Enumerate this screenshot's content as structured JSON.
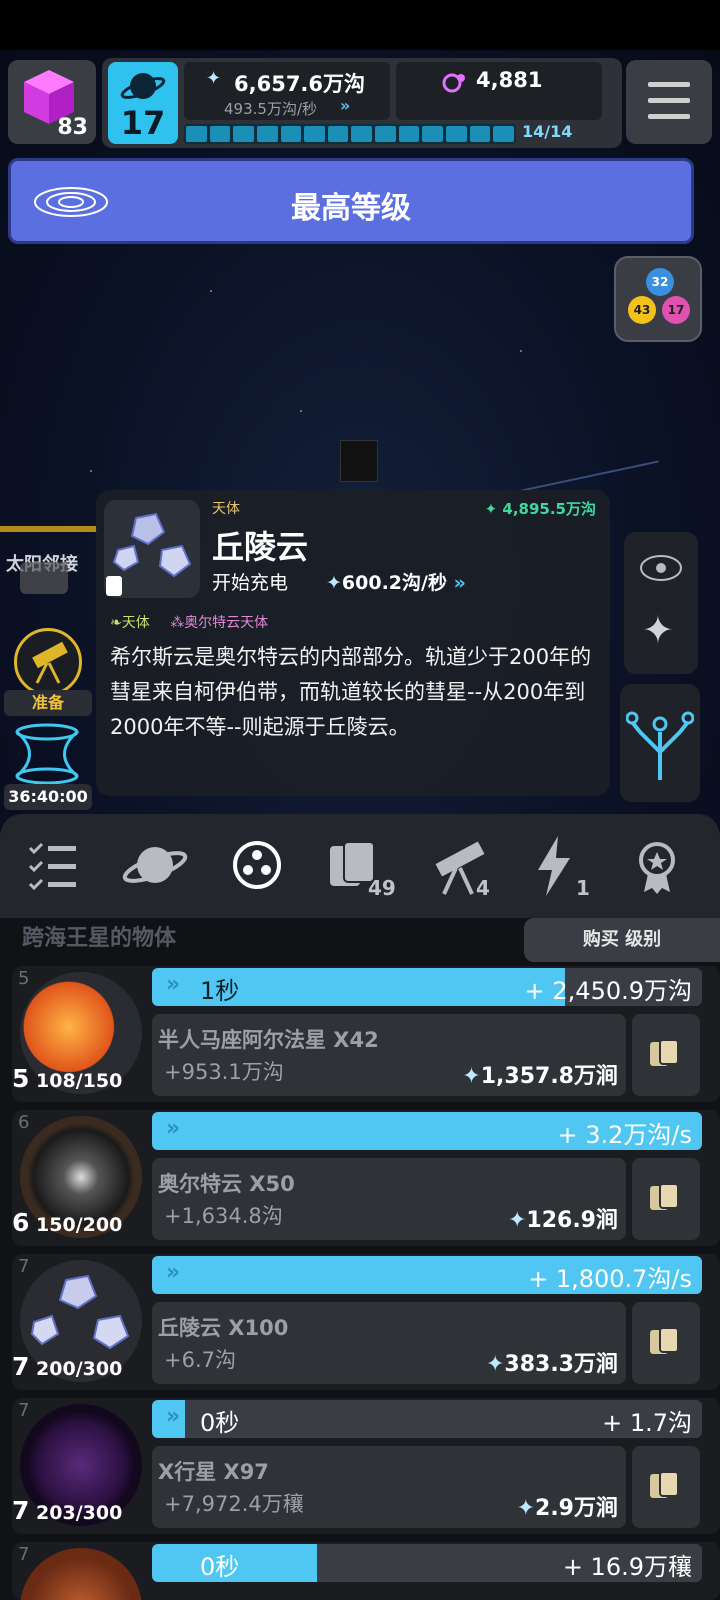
{
  "header": {
    "cube_count": "83",
    "planet_level": "17",
    "energy_value": "6,657.6万沟",
    "energy_rate": "493.5万沟/秒",
    "dark_matter_value": "4,881",
    "progress_text": "14/14",
    "progress_fraction": 1.0
  },
  "banner": {
    "title": "最高等级"
  },
  "combo": {
    "a": "32",
    "b": "43",
    "c": "17"
  },
  "popup": {
    "type": "天体",
    "title": "丘陵云",
    "cost": "4,895.5万沟",
    "rate_label": "开始充电",
    "rate": "600.2沟/秒",
    "tag1": "天体",
    "tag2": "奥尔特云天体",
    "description": "希尔斯云是奥尔特云的内部部分。轨道少于200年的彗星来自柯伊伯带，而轨道较长的彗星--从200年到2000年不等--则起源于丘陵云。"
  },
  "left_panel": {
    "region_label": "太阳邻接",
    "ready_label": "准备",
    "timer": "36:40:00"
  },
  "tabs": [
    {
      "name": "list",
      "badge": ""
    },
    {
      "name": "planet",
      "badge": ""
    },
    {
      "name": "objects",
      "badge": ""
    },
    {
      "name": "cards",
      "badge": "49"
    },
    {
      "name": "telescope",
      "badge": "4"
    },
    {
      "name": "lightning",
      "badge": "1"
    },
    {
      "name": "achievement",
      "badge": ""
    }
  ],
  "list": {
    "header": "跨海王星的物体",
    "buy_level_label": "购买 级别",
    "items": [
      {
        "index": "5",
        "level": "5",
        "progress": "108/150",
        "bar_left": "1秒",
        "bar_right": "+ 2,450.9万沟",
        "fill": 0.75,
        "name": "半人马座阿尔法星  X42",
        "income": "+953.1万沟",
        "cost": "1,357.8万涧"
      },
      {
        "index": "6",
        "level": "6",
        "progress": "150/200",
        "bar_left": "",
        "bar_right": "+ 3.2万沟/s",
        "fill": 1.0,
        "name": "奥尔特云  X50",
        "income": "+1,634.8沟",
        "cost": "126.9涧"
      },
      {
        "index": "7",
        "level": "7",
        "progress": "200/300",
        "bar_left": "",
        "bar_right": "+ 1,800.7沟/s",
        "fill": 1.0,
        "name": "丘陵云  X100",
        "income": "+6.7沟",
        "cost": "383.3万涧"
      },
      {
        "index": "7",
        "level": "7",
        "progress": "203/300",
        "bar_left": "0秒",
        "bar_right": "+ 1.7沟",
        "fill": 0.06,
        "name": "X行星  X97",
        "income": "+7,972.4万穰",
        "cost": "2.9万涧"
      },
      {
        "index": "7",
        "level": "",
        "progress": "",
        "bar_left": "0秒",
        "bar_right": "+ 16.9万穰",
        "fill": 0.3,
        "name": "",
        "income": "",
        "cost": ""
      }
    ]
  },
  "colors": {
    "accent": "#4fc7f2",
    "banner": "#5b6fe0",
    "gold": "#e0b52a"
  }
}
